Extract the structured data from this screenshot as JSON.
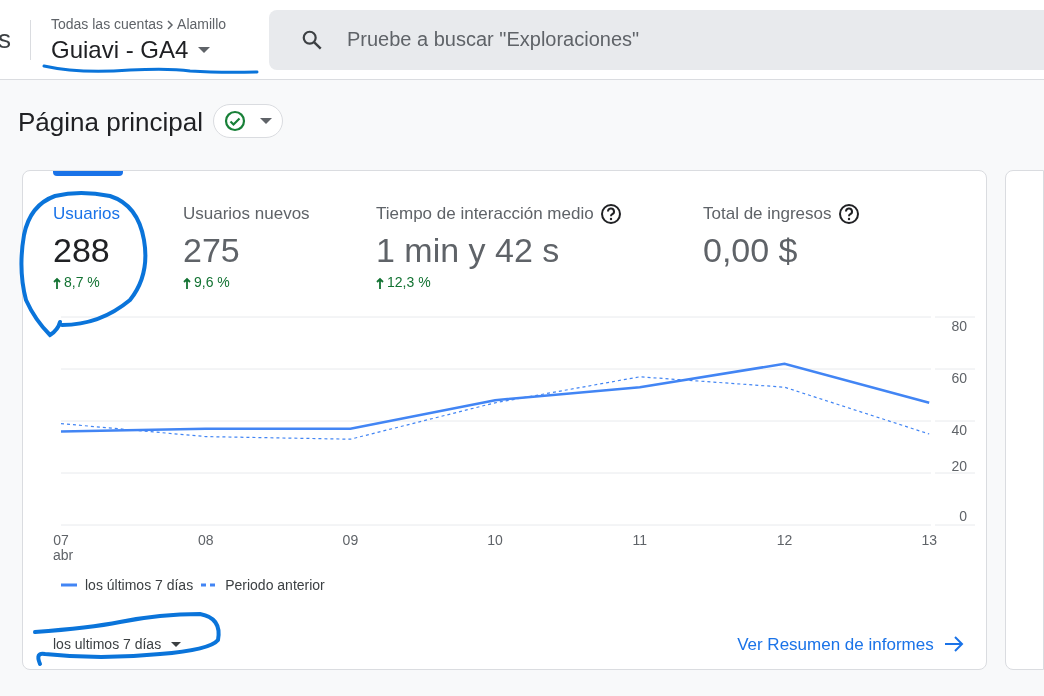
{
  "header": {
    "cut_text": "s",
    "breadcrumb": [
      "Todas las cuentas",
      "Alamillo"
    ],
    "property": "Guiavi - GA4",
    "search": {
      "placeholder": "Pruebe a buscar \"Exploraciones\""
    }
  },
  "page": {
    "title": "Página principal",
    "verified": true
  },
  "card": {
    "metrics": [
      {
        "label": "Usuarios",
        "value": "288",
        "change": "8,7 %",
        "selected": true,
        "help": false
      },
      {
        "label": "Usuarios nuevos",
        "value": "275",
        "change": "9,6 %",
        "selected": false,
        "help": false
      },
      {
        "label": "Tiempo de interacción medio",
        "value": "1 min y 42 s",
        "change": "12,3 %",
        "selected": false,
        "help": true
      },
      {
        "label": "Total de ingresos",
        "value": "0,00 $",
        "selected": false,
        "help": true
      }
    ],
    "month_label": "abr",
    "chart_data": {
      "type": "line",
      "grid": true,
      "categories": [
        "07",
        "08",
        "09",
        "10",
        "11",
        "12",
        "13"
      ],
      "ylim": [
        0,
        80
      ],
      "yticks": [
        0,
        20,
        40,
        60,
        80
      ],
      "series": [
        {
          "name": "los últimos 7 días",
          "color": "#4285f4",
          "line_style": "solid",
          "values": [
            36,
            37,
            37,
            48,
            53,
            62,
            47
          ]
        },
        {
          "name": "Periodo anterior",
          "color": "#4285f4",
          "line_style": "dashed",
          "values": [
            39,
            34,
            33,
            47,
            57,
            53,
            35
          ]
        }
      ]
    },
    "range": "los ultimos 7 días",
    "link": "Ver Resumen de informes"
  },
  "annotations": [
    {
      "kind": "underline"
    },
    {
      "kind": "circle"
    },
    {
      "kind": "loop"
    }
  ]
}
